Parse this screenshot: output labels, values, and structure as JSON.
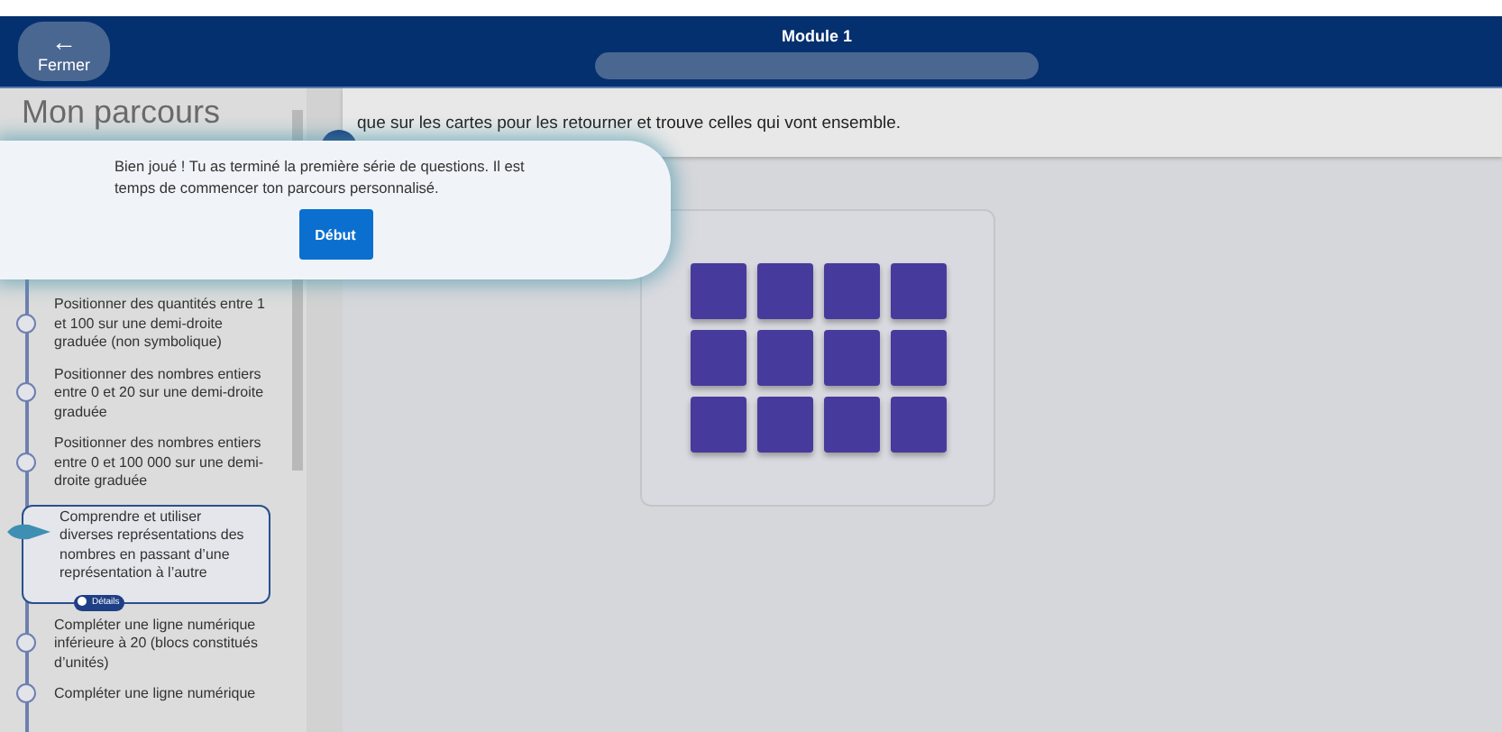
{
  "header": {
    "close_button": {
      "icon": "←",
      "label": "Fermer"
    },
    "title": "Module 1",
    "progress": {
      "level": 0
    }
  },
  "sidebar": {
    "title": "Mon parcours",
    "items": [
      {
        "label": "Positionner des quantités entre 1 et 100 sur une demi-droite graduée (non symbolique)",
        "selected": false
      },
      {
        "label": "Positionner des nombres entiers entre 0 et 20 sur une demi-droite graduée",
        "selected": false
      },
      {
        "label": "Positionner des nombres entiers entre 0 et 100 000 sur une demi-droite graduée",
        "selected": false
      },
      {
        "label": "Comprendre et utiliser diverses représentations des nombres en passant d’une représentation à l’autre",
        "selected": true,
        "details": "Détails"
      },
      {
        "label": "Compléter une ligne numérique inférieure à 20 (blocs constitués d’unités)",
        "selected": false
      },
      {
        "label": "Compléter une ligne numérique",
        "selected": false
      }
    ]
  },
  "main": {
    "instruction": "que sur les cartes pour les retourner et trouve celles qui vont ensemble.",
    "cards": [
      {
        "face_down": true
      },
      {
        "face_down": true
      },
      {
        "face_down": true
      },
      {
        "face_down": true
      },
      {
        "face_down": true
      },
      {
        "face_down": true
      },
      {
        "face_down": true
      },
      {
        "face_down": true
      },
      {
        "face_down": true
      },
      {
        "face_down": true
      },
      {
        "face_down": true
      },
      {
        "face_down": true
      }
    ]
  },
  "popup": {
    "message": "Bien joué ! Tu as terminé la première série de questions. Il est temps de commencer ton parcours personnalisé.",
    "button": "Début"
  }
}
